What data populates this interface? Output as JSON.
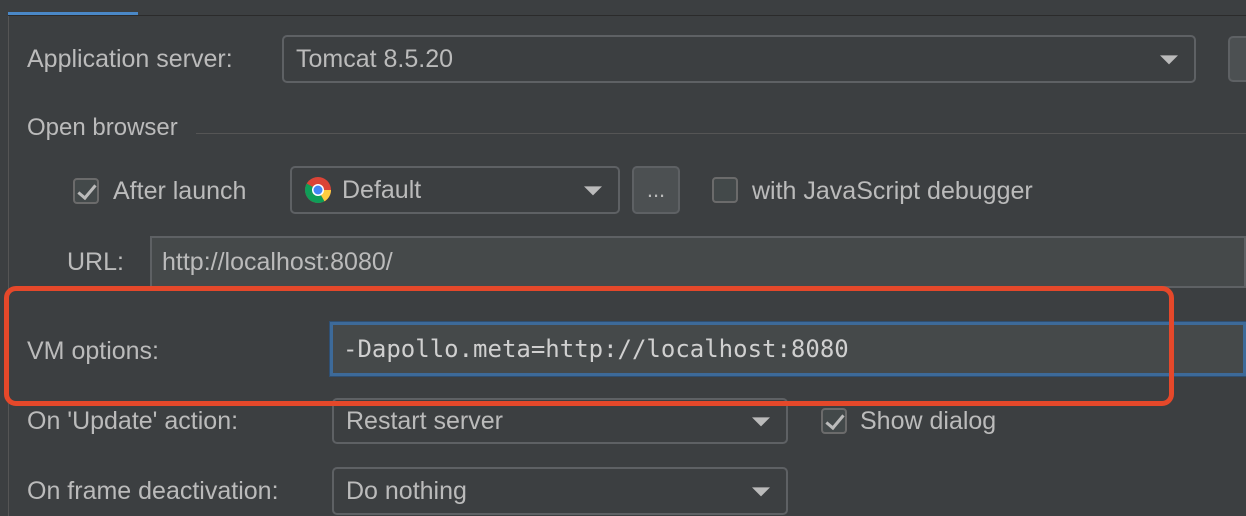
{
  "app_server": {
    "label": "Application server:",
    "value": "Tomcat 8.5.20"
  },
  "open_browser": {
    "section_label": "Open browser",
    "after_launch_label": "After launch",
    "after_launch_checked": true,
    "browser_value": "Default",
    "browser_icon": "chrome-icon",
    "ellipsis_label": "...",
    "js_debugger_label": "with JavaScript debugger",
    "js_debugger_checked": false,
    "url_label": "URL:",
    "url_value": "http://localhost:8080/"
  },
  "vm_options": {
    "label": "VM options:",
    "value": "-Dapollo.meta=http://localhost:8080"
  },
  "update_action": {
    "label": "On 'Update' action:",
    "value": "Restart server",
    "show_dialog_label": "Show dialog",
    "show_dialog_checked": true
  },
  "frame_deactivation": {
    "label": "On frame deactivation:",
    "value": "Do nothing"
  },
  "colors": {
    "background": "#3c3f41",
    "accent": "#4a88c7",
    "highlight": "#e5482a"
  }
}
